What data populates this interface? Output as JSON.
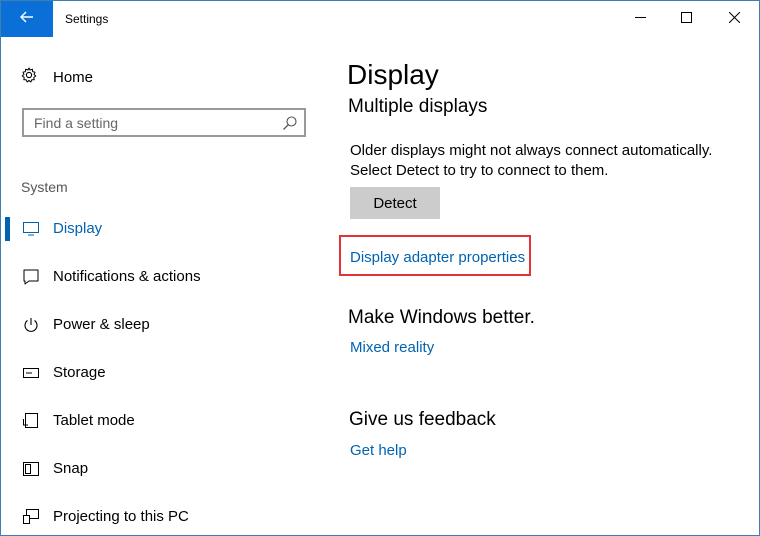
{
  "window": {
    "title": "Settings"
  },
  "sidebar": {
    "home_label": "Home",
    "search": {
      "placeholder": "Find a setting",
      "value": ""
    },
    "section_label": "System",
    "items": [
      {
        "label": "Display",
        "icon": "monitor-icon",
        "selected": true
      },
      {
        "label": "Notifications & actions",
        "icon": "notification-icon",
        "selected": false
      },
      {
        "label": "Power & sleep",
        "icon": "power-icon",
        "selected": false
      },
      {
        "label": "Storage",
        "icon": "storage-icon",
        "selected": false
      },
      {
        "label": "Tablet mode",
        "icon": "tablet-icon",
        "selected": false
      },
      {
        "label": "Snap",
        "icon": "snap-icon",
        "selected": false
      },
      {
        "label": "Projecting to this PC",
        "icon": "projecting-icon",
        "selected": false
      }
    ]
  },
  "main": {
    "title": "Display",
    "multiple_displays": {
      "heading": "Multiple displays",
      "desc_line1": "Older displays might not always connect automatically.",
      "desc_line2": "Select Detect to try to connect to them.",
      "detect_label": "Detect",
      "adapter_link": "Display adapter properties"
    },
    "make_better": {
      "heading": "Make Windows better.",
      "link": "Mixed reality"
    },
    "feedback": {
      "heading": "Give us feedback",
      "link": "Get help"
    }
  },
  "colors": {
    "accent": "#0063b1",
    "back_button": "#0a6fd6",
    "highlight_box": "#e0343a",
    "button_bg": "#cccccc"
  }
}
